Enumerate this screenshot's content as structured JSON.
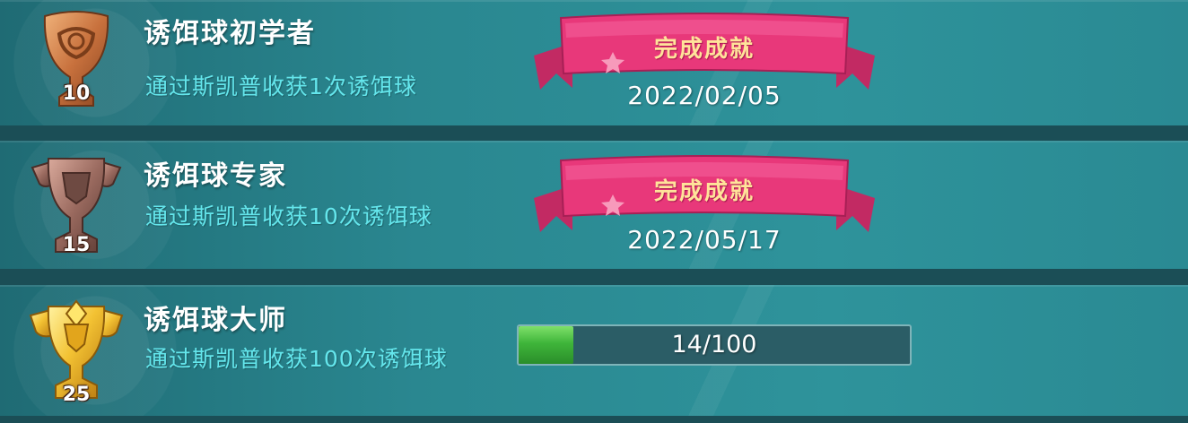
{
  "achievements": [
    {
      "title": "诱饵球初学者",
      "description": "通过斯凯普收获1次诱饵球",
      "points": "10",
      "trophy_tier": "bronze",
      "status_label": "完成成就",
      "date": "2022/02/05"
    },
    {
      "title": "诱饵球专家",
      "description": "通过斯凯普收获10次诱饵球",
      "points": "15",
      "trophy_tier": "silver",
      "status_label": "完成成就",
      "date": "2022/05/17"
    },
    {
      "title": "诱饵球大师",
      "description": "通过斯凯普收获100次诱饵球",
      "points": "25",
      "trophy_tier": "gold",
      "progress_text": "14/100",
      "progress_fraction": 0.14
    }
  ],
  "colors": {
    "background": "#2b8790",
    "description_text": "#64e6ec",
    "ribbon": "#e8387a",
    "ribbon_text": "#ffe39a",
    "progress_fill": "#3fb53a"
  },
  "icons": [
    "bronze-trophy-icon",
    "silver-trophy-icon",
    "gold-trophy-icon",
    "ribbon-banner-icon"
  ]
}
